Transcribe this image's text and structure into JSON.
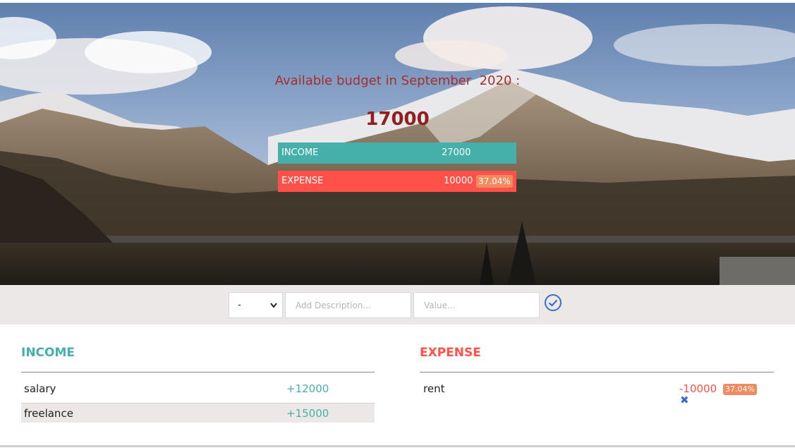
{
  "header": {
    "title_prefix": "Available budget in",
    "month": "September",
    "year": "2020",
    "title_suffix": ":",
    "available_budget": "17000",
    "income_label": "INCOME",
    "income_total": "27000",
    "expense_label": "EXPENSE",
    "expense_total": "10000",
    "expense_percentage": "37.04%"
  },
  "add_form": {
    "type_value": "-",
    "description_placeholder": "Add Description...",
    "value_placeholder": "Value...",
    "submit_icon": "check-circle-icon"
  },
  "income": {
    "title": "INCOME",
    "items": [
      {
        "description": "salary",
        "value": "+12000"
      },
      {
        "description": "freelance",
        "value": "+15000"
      }
    ]
  },
  "expense": {
    "title": "EXPENSE",
    "items": [
      {
        "description": "rent",
        "value": "-10000",
        "percentage": "37.04%",
        "delete_icon": "close-icon"
      }
    ]
  },
  "colors": {
    "income": "#45b0aa",
    "expense": "#ff5049",
    "percentage_badge": "#f38a5f",
    "title": "#a62e2e",
    "check_icon": "#3a6fc4"
  }
}
